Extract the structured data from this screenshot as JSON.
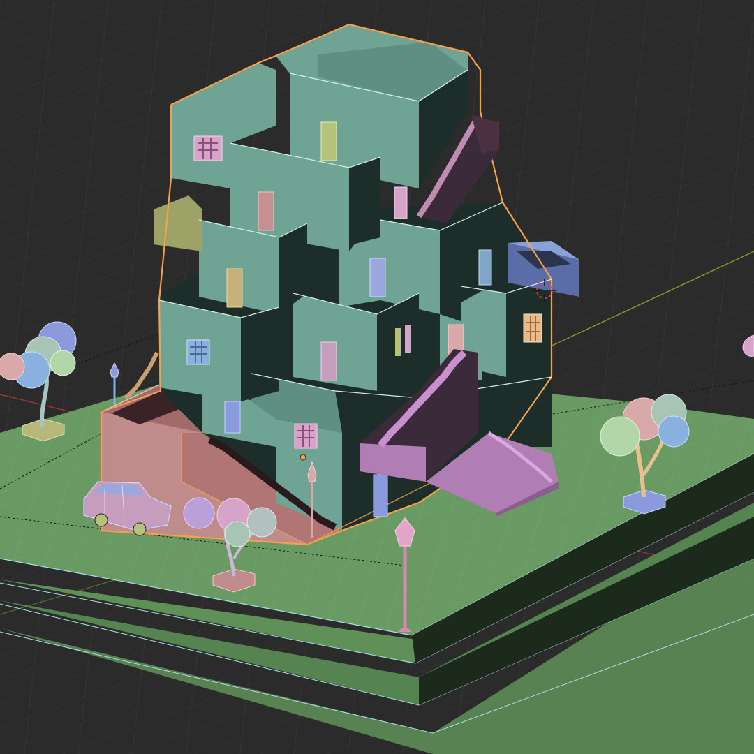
{
  "viewport": {
    "mode": "object",
    "shading": "solid",
    "selection_outline_color": "#f5a14a",
    "background_color": "#2b2b2b"
  },
  "colors": {
    "grid_line": "#3a3a3a",
    "axis_x": "#b23a3a",
    "axis_y": "#7c9a2c",
    "ground": "#6a9a63",
    "ground_side": "#5d8c57",
    "wall_light": "#6fa394",
    "wall_dark": "#1d2e2a",
    "stair": "#b07db5",
    "stair_dark": "#3a2a3a",
    "terrace": "#c08b8b",
    "wireframe": "#d5f1e8"
  },
  "objects": [
    {
      "name": "building",
      "icon": "building-icon",
      "selected": true
    },
    {
      "name": "stairs-front",
      "icon": "stairs-icon",
      "selected": false
    },
    {
      "name": "stairs-upper",
      "icon": "stairs-icon",
      "selected": false
    },
    {
      "name": "terrace-wall",
      "icon": "wall-icon",
      "selected": false
    },
    {
      "name": "car",
      "icon": "car-icon",
      "selected": false
    },
    {
      "name": "tree-left",
      "icon": "tree-icon",
      "selected": false
    },
    {
      "name": "tree-front",
      "icon": "tree-icon",
      "selected": false
    },
    {
      "name": "tree-right",
      "icon": "tree-icon",
      "selected": false
    },
    {
      "name": "lamp-front",
      "icon": "street-lamp-icon",
      "selected": false
    },
    {
      "name": "lamp-left",
      "icon": "street-lamp-icon",
      "selected": false
    },
    {
      "name": "lamp-terrace",
      "icon": "street-lamp-icon",
      "selected": false
    },
    {
      "name": "ground-plinth",
      "icon": "plane-icon",
      "selected": false
    }
  ],
  "cursor": {
    "icon": "3d-cursor-icon"
  }
}
